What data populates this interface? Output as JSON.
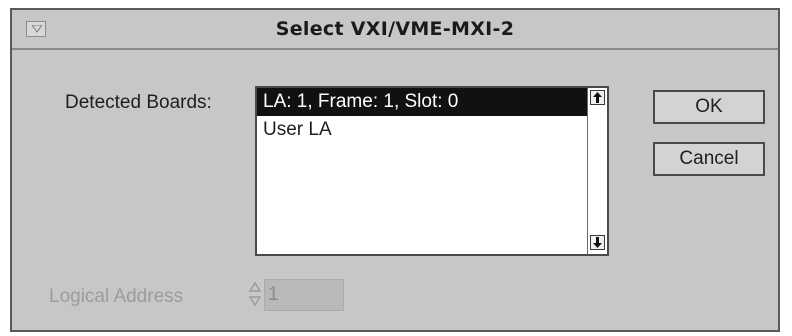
{
  "window": {
    "title": "Select VXI/VME-MXI-2"
  },
  "detected_boards": {
    "label": "Detected Boards:",
    "items": [
      {
        "label": "LA: 1, Frame: 1, Slot: 0",
        "selected": true
      },
      {
        "label": "User LA",
        "selected": false
      }
    ]
  },
  "buttons": {
    "ok": "OK",
    "cancel": "Cancel"
  },
  "logical_address": {
    "label": "Logical Address",
    "value": "1",
    "enabled": false
  },
  "colors": {
    "dialog_bg": "#c7c7c7",
    "selection_bg": "#111111",
    "disabled_text": "#9c9c9c"
  }
}
